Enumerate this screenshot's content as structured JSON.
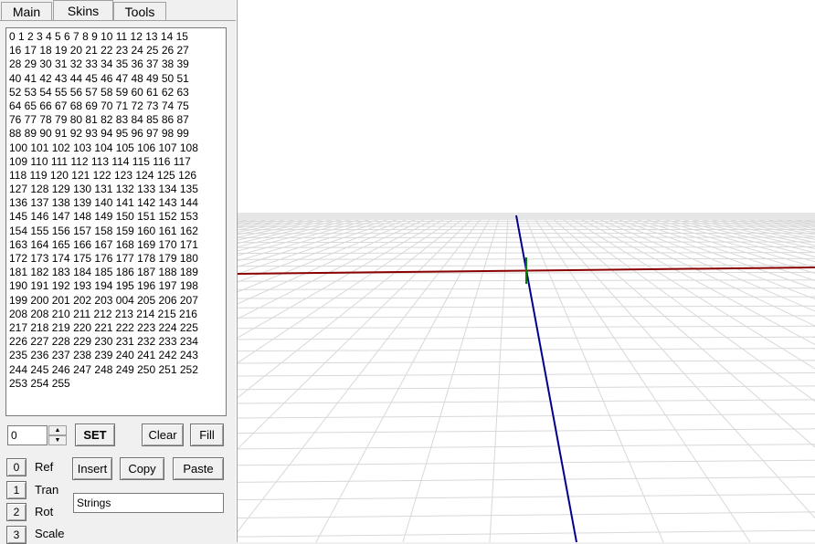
{
  "tabs": [
    {
      "label": "Main"
    },
    {
      "label": "Skins"
    },
    {
      "label": "Tools"
    }
  ],
  "active_tab": "Skins",
  "skin_list": {
    "lines": [
      "0 1 2 3 4 5 6 7 8 9 10 11 12 13 14 15",
      "16 17 18 19 20 21 22 23 24 25 26 27",
      "28 29 30 31 32 33 34 35 36 37 38 39",
      "40 41 42 43 44 45 46 47 48 49 50 51",
      "52 53 54 55 56 57 58 59 60 61 62 63",
      "64 65 66 67 68 69 70 71 72 73 74 75",
      "76 77 78 79 80 81 82 83 84 85 86 87",
      "88 89 90 91 92 93 94 95 96 97 98 99",
      "100 101 102 103 104 105 106 107 108",
      "109 110 111 112 113 114 115 116 117",
      "118 119 120 121 122 123 124 125 126",
      "127 128 129 130 131 132 133 134 135",
      "136 137 138 139 140 141 142 143 144",
      "145 146 147 148 149 150 151 152 153",
      "154 155 156 157 158 159 160 161 162",
      "163 164 165 166 167 168 169 170 171",
      "172 173 174 175 176 177 178 179 180",
      "181 182 183 184 185 186 187 188 189",
      "190 191 192 193 194 195 196 197 198",
      "199 200 201 202 203 004 205 206 207",
      "208 208 210 211 212 213 214 215 216",
      "217 218 219 220 221 222 223 224 225",
      "226 227 228 229 230 231 232 233 234",
      "235 236 237 238 239 240 241 242 243",
      "244 245 246 247 248 249 250 251 252",
      "253 254 255"
    ]
  },
  "controls": {
    "spin_value": "0",
    "set_label": "SET",
    "clear_label": "Clear",
    "fill_label": "Fill",
    "insert_label": "Insert",
    "copy_label": "Copy",
    "paste_label": "Paste",
    "strings_value": "Strings"
  },
  "rows": [
    {
      "key": "0",
      "label": "Ref"
    },
    {
      "key": "1",
      "label": "Tran"
    },
    {
      "key": "2",
      "label": "Rot"
    },
    {
      "key": "3",
      "label": "Scale"
    }
  ],
  "viewport": {
    "grid_color": "#d8d8d8",
    "x_axis_color": "#8b0000",
    "z_axis_color": "#00008b",
    "y_axis_color": "#008000"
  }
}
